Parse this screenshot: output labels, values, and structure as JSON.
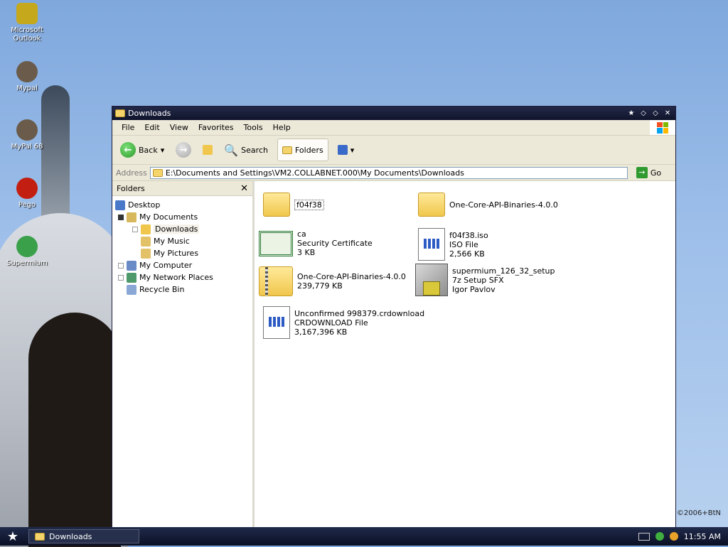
{
  "desktop": {
    "icons": [
      {
        "name": "outlook-icon",
        "label": "Microsoft Outlook",
        "color": "#c5a81c"
      },
      {
        "name": "mypal-icon",
        "label": "Mypal",
        "color": "#6b5b4a"
      },
      {
        "name": "mypal68-icon",
        "label": "MyPal 68",
        "color": "#6b5b4a"
      },
      {
        "name": "pego-icon",
        "label": "Pego",
        "color": "#c21e12"
      },
      {
        "name": "supermium-icon",
        "label": "Supermium",
        "color": "#3aa04a"
      }
    ],
    "watermark": "©2006+BtN"
  },
  "window": {
    "title": "Downloads",
    "menu": [
      "File",
      "Edit",
      "View",
      "Favorites",
      "Tools",
      "Help"
    ],
    "toolbar": {
      "back": "Back",
      "search": "Search",
      "folders": "Folders"
    },
    "address": {
      "label": "Address",
      "value": "E:\\Documents and Settings\\VM2.COLLABNET.000\\My Documents\\Downloads",
      "go": "Go"
    },
    "folders_pane": {
      "title": "Folders",
      "tree": [
        {
          "label": "Desktop",
          "icon": "desktop-icon"
        },
        {
          "label": "My Documents",
          "icon": "my-documents-icon"
        },
        {
          "label": "Downloads",
          "icon": "folder-icon"
        },
        {
          "label": "My Music",
          "icon": "music-folder-icon"
        },
        {
          "label": "My Pictures",
          "icon": "pictures-folder-icon"
        },
        {
          "label": "My Computer",
          "icon": "computer-icon"
        },
        {
          "label": "My Network Places",
          "icon": "network-icon"
        },
        {
          "label": "Recycle Bin",
          "icon": "recycle-bin-icon"
        }
      ]
    },
    "files": [
      {
        "name": "f04f38",
        "line2": "",
        "line3": ""
      },
      {
        "name": "One-Core-API-Binaries-4.0.0",
        "line2": "",
        "line3": ""
      },
      {
        "name": "ca",
        "line2": "Security Certificate",
        "line3": "3 KB"
      },
      {
        "name": "f04f38.iso",
        "line2": "ISO File",
        "line3": "2,566 KB"
      },
      {
        "name": "One-Core-API-Binaries-4.0.0",
        "line2": "239,779 KB",
        "line3": ""
      },
      {
        "name": "supermium_126_32_setup",
        "line2": "7z Setup SFX",
        "line3": "Igor Pavlov"
      },
      {
        "name": "Unconfirmed 998379.crdownload",
        "line2": "CRDOWNLOAD File",
        "line3": "3,167,396 KB"
      }
    ]
  },
  "taskbar": {
    "task": "Downloads",
    "time": "11:55 AM"
  }
}
